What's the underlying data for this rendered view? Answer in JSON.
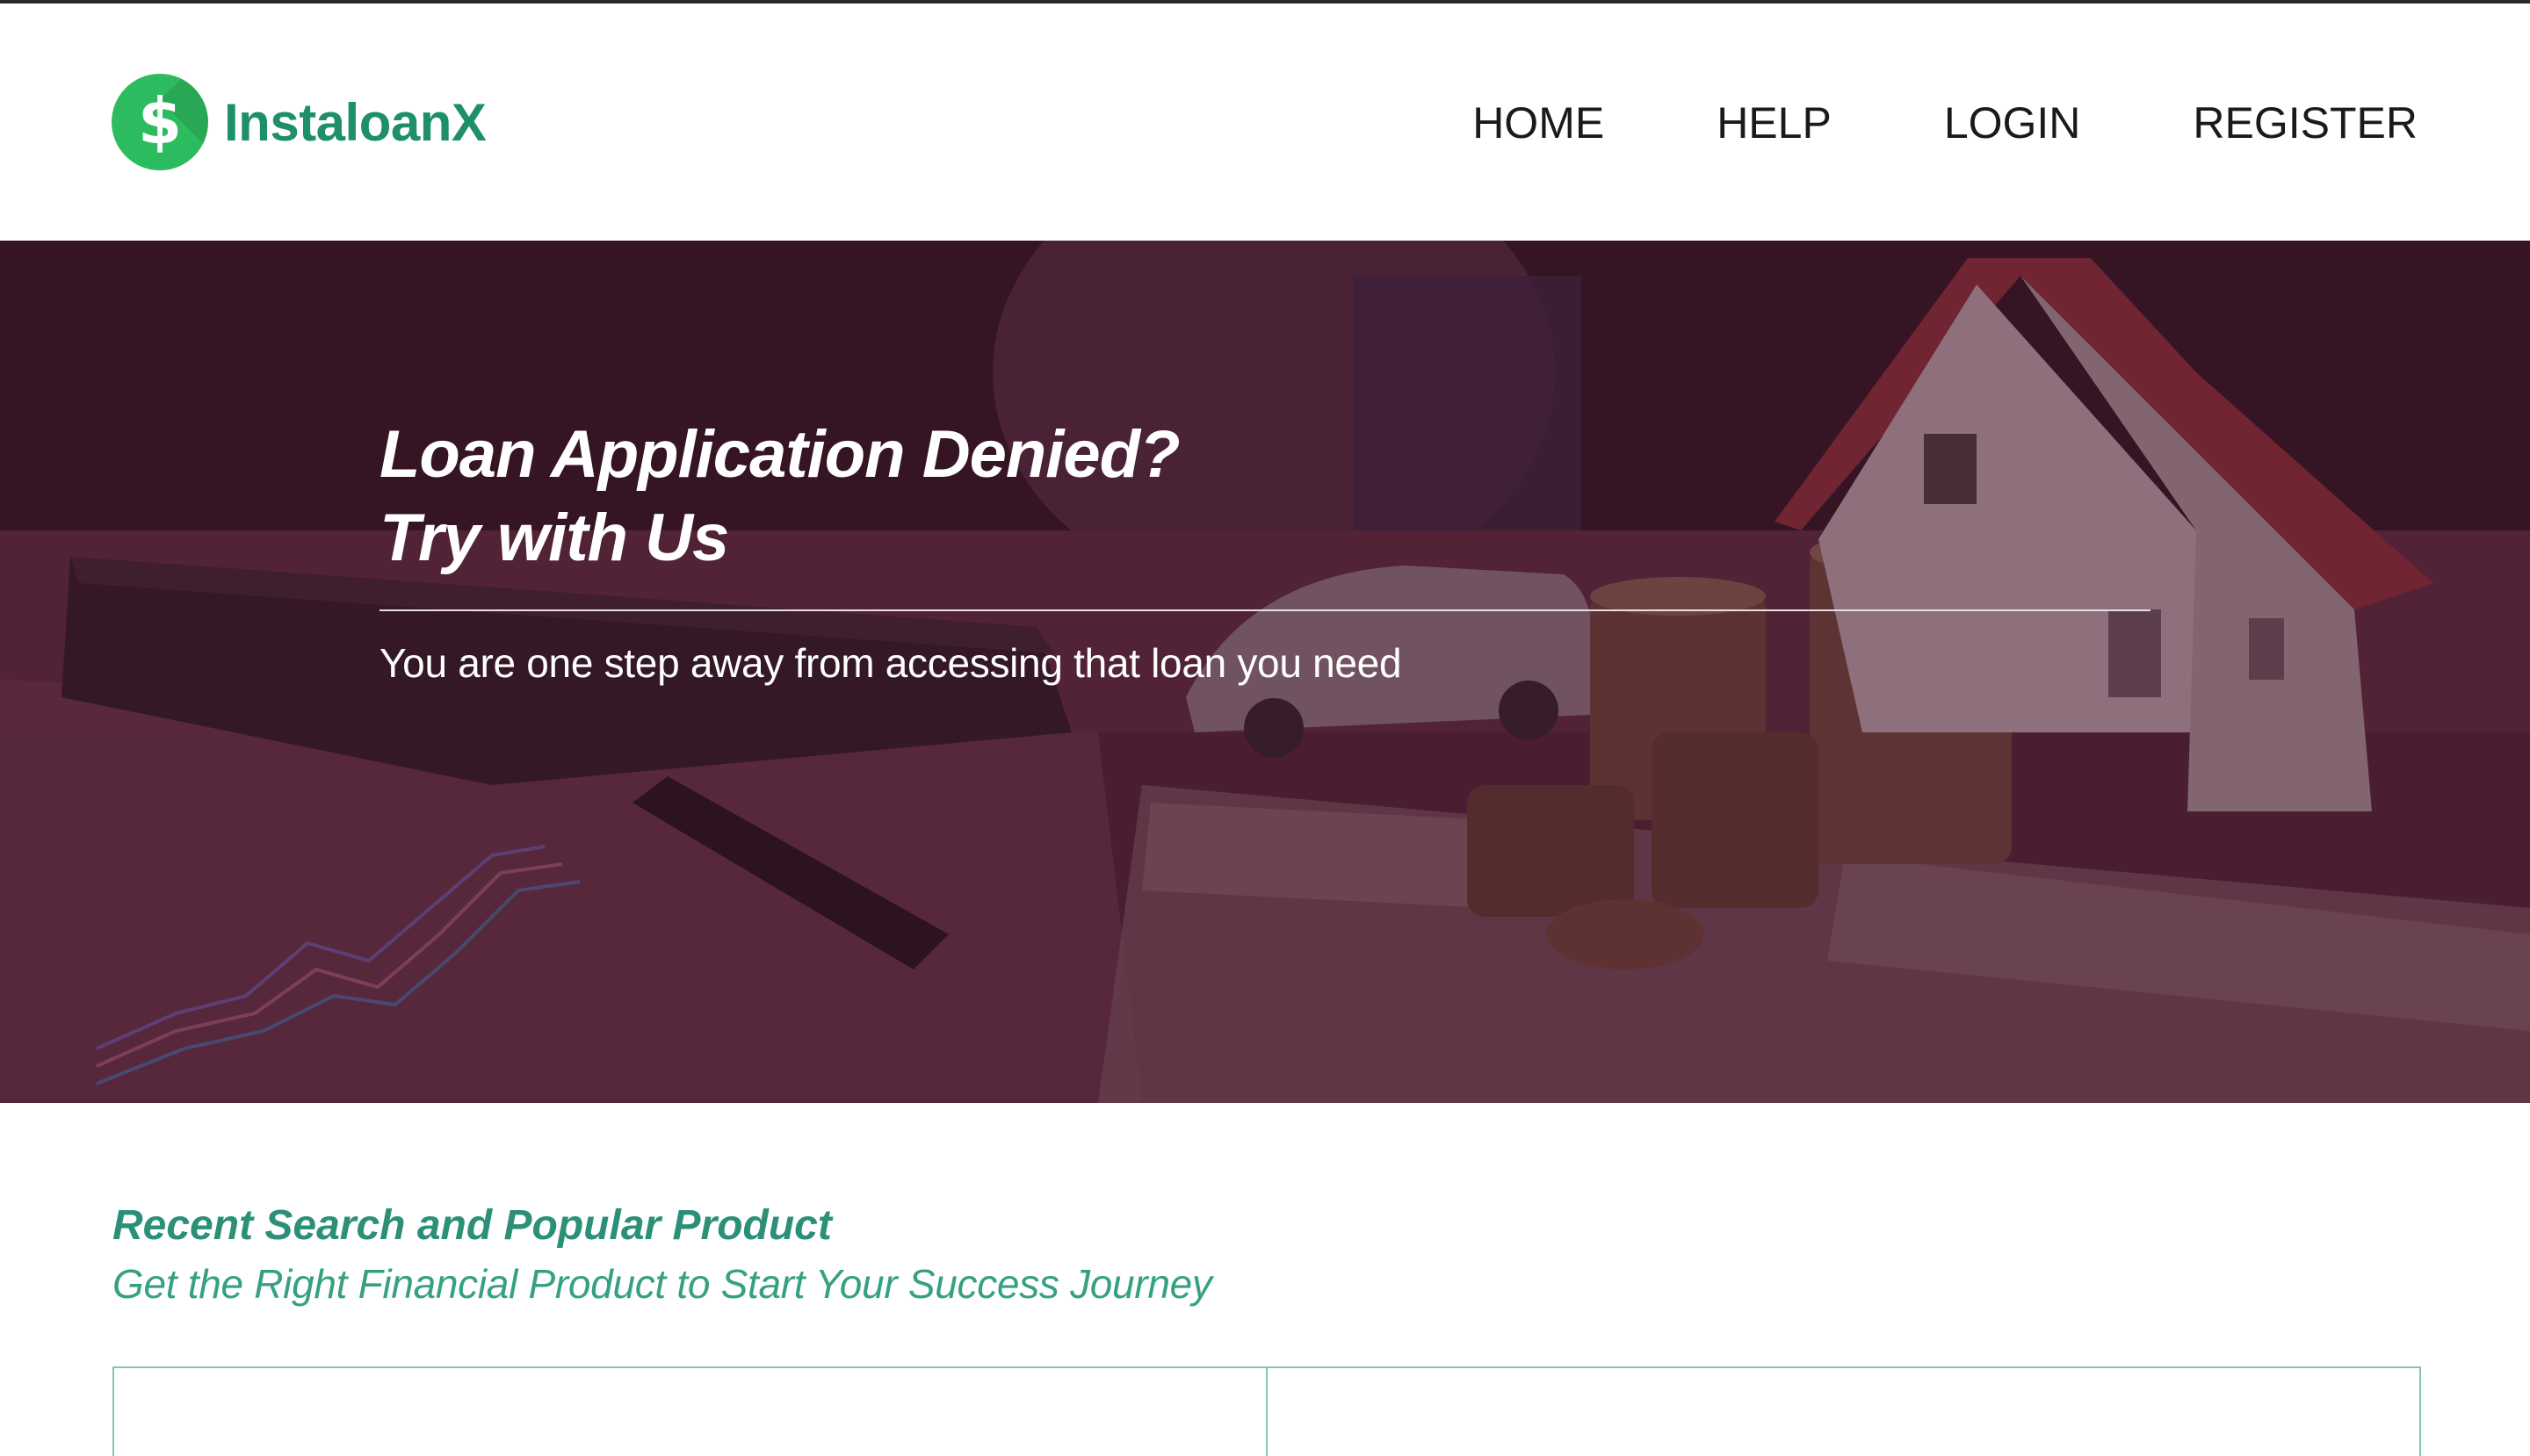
{
  "brand": {
    "name": "InstaloanX",
    "logo_icon": "dollar-circle-icon",
    "logo_color": "#2dbb5f",
    "text_color": "#1f8f6b"
  },
  "nav": {
    "items": [
      "HOME",
      "HELP",
      "LOGIN",
      "REGISTER"
    ]
  },
  "hero": {
    "title_line1": "Loan Application Denied?",
    "title_line2": "Try with Us",
    "subtitle": "You are one step away from accessing that loan you need",
    "overlay_color": "#46162c"
  },
  "section": {
    "title": "Recent Search and Popular Product",
    "subtitle": "Get the Right Financial Product to Start Your Success Journey",
    "accent_color": "#2c8f78"
  }
}
